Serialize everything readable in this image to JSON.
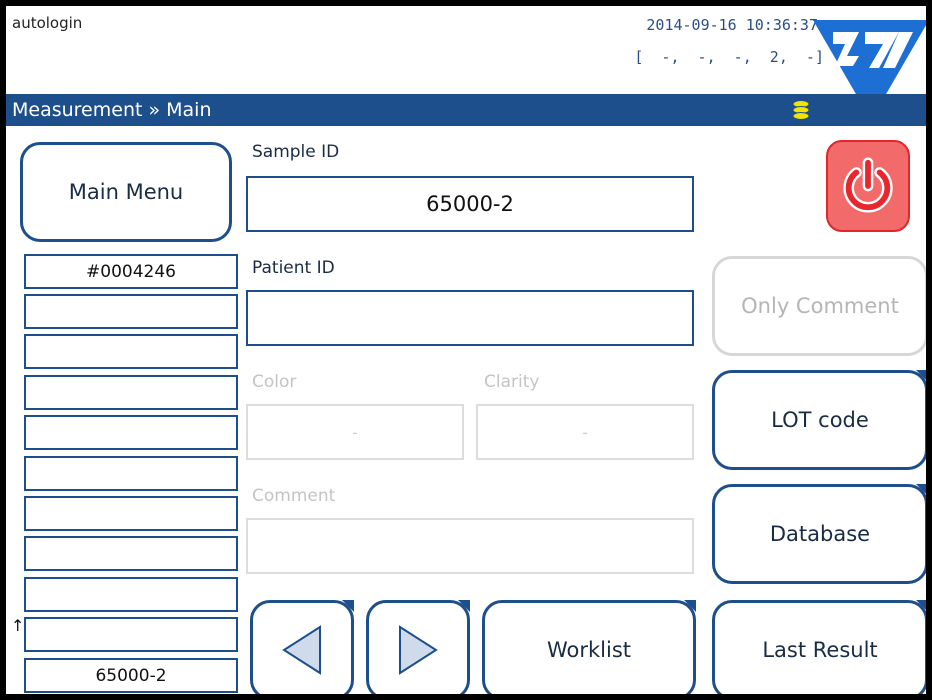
{
  "header": {
    "user": "autologin",
    "datetime": "2014-09-16 10:36:37",
    "status": "[  -,  -,  -,  2,  -]"
  },
  "titlebar": {
    "breadcrumb": "Measurement » Main",
    "db_icon": "database-stack-icon",
    "db_icon_color": "#f3e300"
  },
  "buttons": {
    "main_menu": "Main Menu",
    "power_icon": "power-icon",
    "only_comment": "Only Comment",
    "lot_code": "LOT code",
    "database": "Database",
    "worklist": "Worklist",
    "last_result": "Last Result",
    "prev_icon": "triangle-left-icon",
    "next_icon": "triangle-right-icon"
  },
  "form": {
    "sample_id_label": "Sample ID",
    "sample_id_value": "65000-2",
    "patient_id_label": "Patient ID",
    "patient_id_value": "",
    "color_label": "Color",
    "color_value": "-",
    "clarity_label": "Clarity",
    "clarity_value": "-",
    "comment_label": "Comment",
    "comment_value": ""
  },
  "list": {
    "top_id": "#0004246",
    "rows": [
      "",
      "",
      "",
      "",
      "",
      "",
      "",
      "",
      ""
    ],
    "current": "65000-2",
    "arrow": "↑"
  },
  "colors": {
    "accent": "#1d4f8c",
    "power_red": "#e8262d",
    "power_bg": "#f26a6a"
  }
}
